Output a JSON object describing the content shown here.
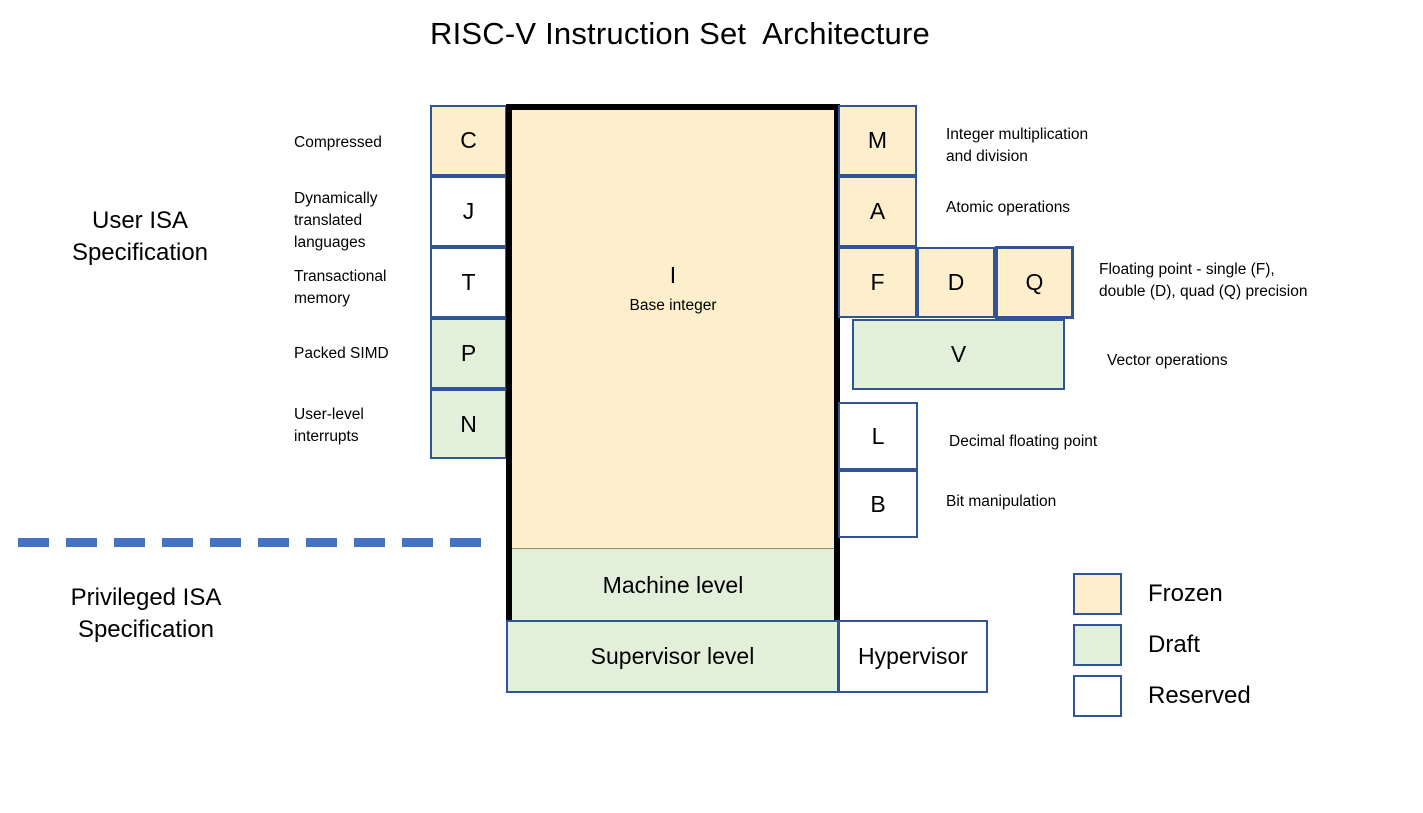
{
  "title": "RISC-V Instruction Set  Architecture",
  "sections": {
    "user_isa": "User ISA\nSpecification",
    "privileged_isa": "Privileged ISA\nSpecification"
  },
  "left_extensions": [
    {
      "letter": "C",
      "note": "Compressed",
      "status": "frozen"
    },
    {
      "letter": "J",
      "note": "Dynamically\ntranslated\nlanguages",
      "status": "reserved"
    },
    {
      "letter": "T",
      "note": "Transactional\nmemory",
      "status": "reserved"
    },
    {
      "letter": "P",
      "note": "Packed SIMD",
      "status": "draft"
    },
    {
      "letter": "N",
      "note": "User-level\ninterrupts",
      "status": "draft"
    }
  ],
  "right_extensions": [
    {
      "letter": "M",
      "note": "Integer multiplication\nand division",
      "status": "frozen"
    },
    {
      "letter": "A",
      "note": "Atomic operations",
      "status": "frozen"
    },
    {
      "letter": "F",
      "note": "Floating point - single (F),\ndouble (D), quad (Q) precision",
      "status": "frozen"
    },
    {
      "letter": "D",
      "note": "",
      "status": "frozen"
    },
    {
      "letter": "Q",
      "note": "",
      "status": "frozen"
    },
    {
      "letter": "V",
      "note": "Vector operations",
      "status": "draft"
    },
    {
      "letter": "L",
      "note": "Decimal floating point",
      "status": "reserved"
    },
    {
      "letter": "B",
      "note": "Bit manipulation",
      "status": "reserved"
    }
  ],
  "core": {
    "letter": "I",
    "subtitle": "Base integer",
    "machine_level": "Machine level"
  },
  "privileged": {
    "supervisor_level": "Supervisor level",
    "hypervisor": "Hypervisor"
  },
  "legend": {
    "items": [
      {
        "label": "Frozen",
        "color": "#FDEECC"
      },
      {
        "label": "Draft",
        "color": "#E2EFDA"
      },
      {
        "label": "Reserved",
        "color": "#FFFFFF"
      }
    ],
    "border_color": "#2F5597"
  },
  "divider": {
    "color": "#4472C4",
    "style": "dashed"
  }
}
